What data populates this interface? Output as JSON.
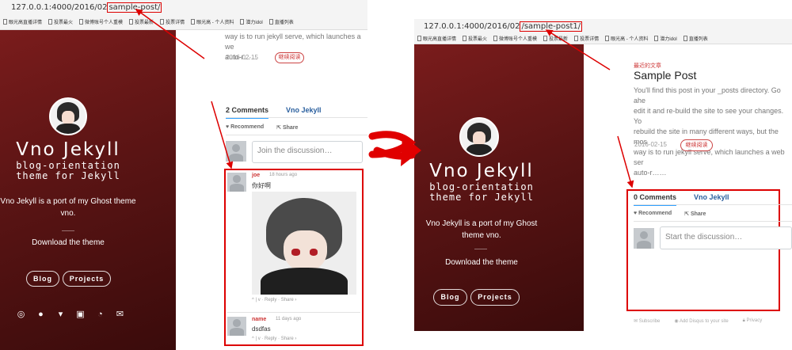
{
  "left": {
    "url_prefix": "127.0.0.1:4000/2016/02",
    "url_highlight": "sample-post/",
    "bookmarks": [
      "眼光高直播详情",
      "投票最火",
      "微博账号个人重模",
      "投票最新",
      "投票详情",
      "眼光高 - 个人资料",
      "潜力idol",
      "直播列表"
    ],
    "site_title": "Vno Jekyll",
    "site_subtitle": "blog-orientation theme for Jekyll",
    "site_description": "Vno Jekyll is a port of my Ghost theme vno.",
    "download_label": "Download the theme",
    "blog_label": "Blog",
    "projects_label": "Projects",
    "social_icons": [
      "weibo-icon",
      "github-icon",
      "twitter-icon",
      "google-plus-icon",
      "rss-icon",
      "mail-icon"
    ],
    "excerpt_line1": "way is to run jekyll serve, which launches a we",
    "excerpt_line2": "auto-r……",
    "date": "2016-02-15",
    "readmore": "继续阅读",
    "tab_comments": "2 Comments",
    "tab_site": "Vno Jekyll",
    "recommend": "Recommend",
    "share": "Share",
    "input_placeholder": "Join the discussion…",
    "comments": [
      {
        "author": "joe",
        "time": "18 hours ago",
        "text": "你好啊",
        "meta": "^ | v · Reply · Share ›"
      },
      {
        "author": "name",
        "time": "11 days ago",
        "text": "dsdfas",
        "meta": "^ | v · Reply · Share ›"
      }
    ]
  },
  "right": {
    "url_prefix": "127.0.0.1:4000/2016/02",
    "url_highlight": "/sample-post1/",
    "bookmarks": [
      "眼光高直播详情",
      "投票最火",
      "微博账号个人重模",
      "投票最新",
      "投票详情",
      "眼光高 - 个人资料",
      "潜力idol",
      "直播列表"
    ],
    "site_title": "Vno Jekyll",
    "site_subtitle": "blog-orientation theme for Jekyll",
    "site_description": "Vno Jekyll is a port of my Ghost theme vno.",
    "download_label": "Download the theme",
    "blog_label": "Blog",
    "projects_label": "Projects",
    "recent_label": "最近的文章",
    "post_title": "Sample Post",
    "excerpt_lines": [
      "You'll find this post in your _posts directory. Go ahe",
      "edit it and re-build the site to see your changes. Yo",
      "rebuild the site in many different ways, but the mos",
      "way is to run jekyll serve, which launches a web ser",
      "auto-r……"
    ],
    "date": "2016-02-15",
    "readmore": "继续阅读",
    "tab_comments": "0 Comments",
    "tab_site": "Vno Jekyll",
    "recommend": "Recommend",
    "share": "Share",
    "input_placeholder": "Start the discussion…",
    "footer_subscribe": "Subscribe",
    "footer_disqus": "Add Disqus to your site",
    "footer_privacy": "Privacy"
  },
  "colors": {
    "annotation": "#dd0000",
    "sidebar": "#5a1414",
    "accent": "#cc3333",
    "disqus_tab": "#2e9fff"
  }
}
